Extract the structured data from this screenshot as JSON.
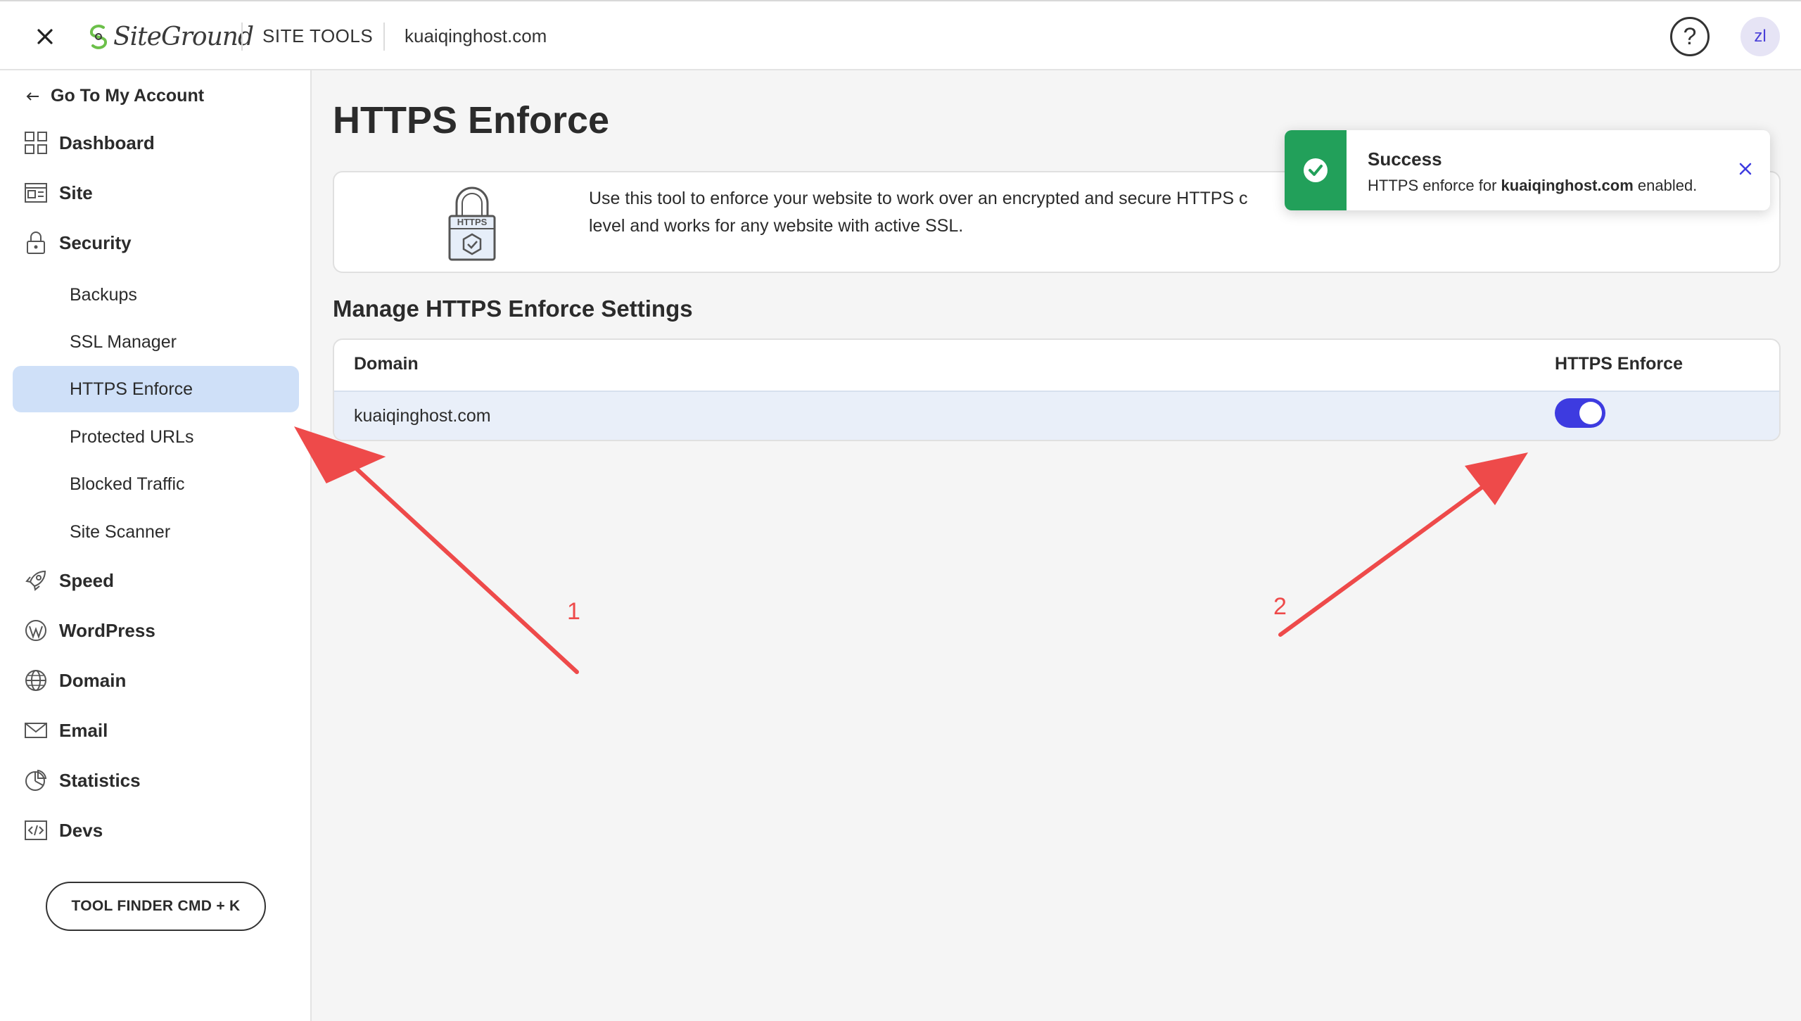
{
  "header": {
    "logo_text": "SiteGround",
    "section": "SITE TOOLS",
    "domain": "kuaiqinghost.com",
    "help_label": "?",
    "avatar_initials": "zl"
  },
  "sidebar": {
    "back_label": "Go To My Account",
    "items": {
      "dashboard": "Dashboard",
      "site": "Site",
      "security": "Security",
      "speed": "Speed",
      "wordpress": "WordPress",
      "domain": "Domain",
      "email": "Email",
      "statistics": "Statistics",
      "devs": "Devs"
    },
    "security_sub": [
      {
        "label": "Backups",
        "active": false
      },
      {
        "label": "SSL Manager",
        "active": false
      },
      {
        "label": "HTTPS Enforce",
        "active": true
      },
      {
        "label": "Protected URLs",
        "active": false
      },
      {
        "label": "Blocked Traffic",
        "active": false
      },
      {
        "label": "Site Scanner",
        "active": false
      }
    ],
    "tool_finder": "TOOL FINDER CMD + K"
  },
  "main": {
    "title": "HTTPS Enforce",
    "info_icon_text": "HTTPS",
    "info_text": "Use this tool to enforce your website to work over an encrypted and secure HTTPS c",
    "info_text_line2": "level and works for any website with active SSL.",
    "section_title": "Manage HTTPS Enforce Settings",
    "table": {
      "headers": {
        "domain": "Domain",
        "https": "HTTPS Enforce"
      },
      "rows": [
        {
          "domain": "kuaiqinghost.com",
          "https_enforced": true
        }
      ]
    }
  },
  "toast": {
    "title": "Success",
    "message_prefix": "HTTPS enforce for ",
    "message_domain": "kuaiqinghost.com",
    "message_suffix": " enabled."
  },
  "annotations": {
    "label_1": "1",
    "label_2": "2"
  },
  "colors": {
    "accent": "#3d3be0",
    "active_nav": "#cfe0f8",
    "success": "#22a05a",
    "annotation": "#ee4a4a",
    "logo_green": "#6cc04a"
  }
}
